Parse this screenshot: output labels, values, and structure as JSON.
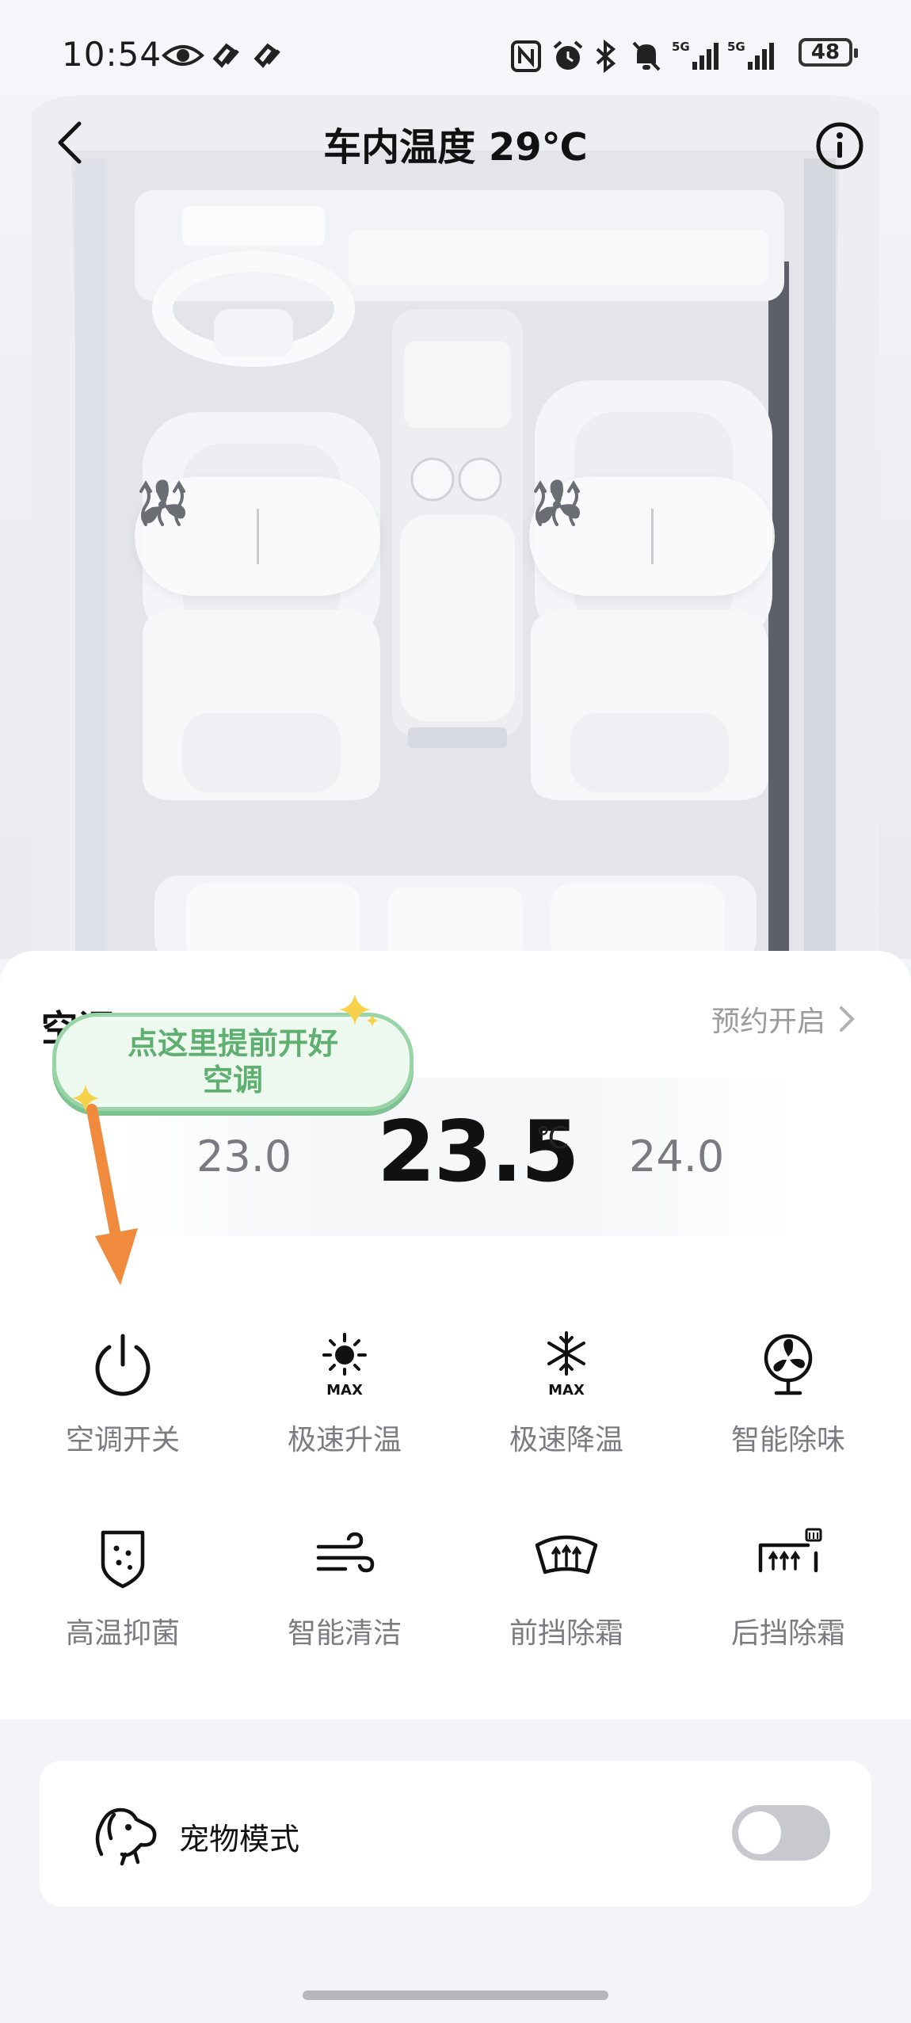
{
  "status_bar": {
    "time": "10:54",
    "battery": "48"
  },
  "header": {
    "title": "车内温度 29℃"
  },
  "climate": {
    "section_title": "空调",
    "schedule_label": "预约开启",
    "temp_prev": "23.0",
    "temp_current": "23.5",
    "temp_unit": "℃",
    "temp_next": "24.0"
  },
  "tooltip": {
    "line1": "点这里提前开好",
    "line2": "空调"
  },
  "controls": [
    {
      "label": "空调开关",
      "icon": "power-icon"
    },
    {
      "label": "极速升温",
      "icon": "sun-max-icon"
    },
    {
      "label": "极速降温",
      "icon": "snowflake-max-icon"
    },
    {
      "label": "智能除味",
      "icon": "fan-icon"
    },
    {
      "label": "高温抑菌",
      "icon": "shield-dots-icon"
    },
    {
      "label": "智能清洁",
      "icon": "wind-icon"
    },
    {
      "label": "前挡除霜",
      "icon": "front-defrost-icon"
    },
    {
      "label": "后挡除霜",
      "icon": "rear-defrost-icon"
    }
  ],
  "pet_mode": {
    "label": "宠物模式",
    "enabled": false
  },
  "colors": {
    "tooltip_green": "#5fb070",
    "arrow_orange": "#f08a3c",
    "sparkle_yellow": "#f5d24a"
  }
}
